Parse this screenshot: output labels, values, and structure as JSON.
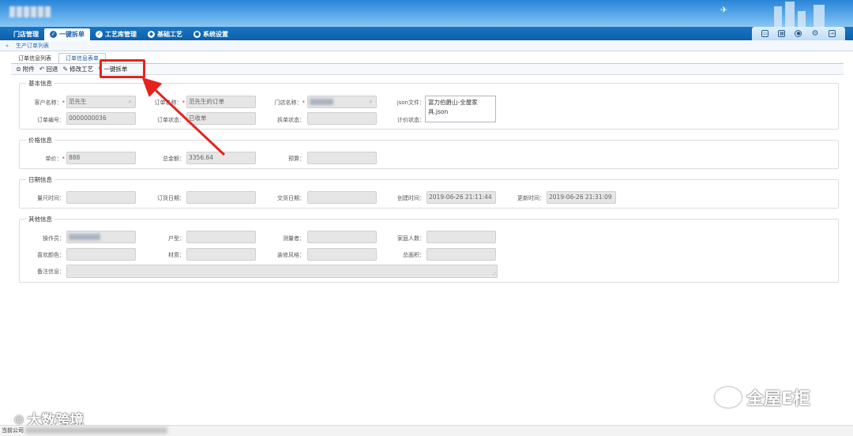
{
  "header": {
    "nav": [
      {
        "label": "门店管理",
        "icon": ""
      },
      {
        "label": "一键拆单",
        "icon": "check-circle-icon",
        "active": true
      },
      {
        "label": "工艺库管理",
        "icon": "check-circle-icon"
      },
      {
        "label": "基础工艺",
        "icon": "compass-icon"
      },
      {
        "label": "系统设置",
        "icon": "gear-circle-icon"
      }
    ],
    "tools": [
      "monitor-icon",
      "calendar-icon",
      "users-icon",
      "gear-icon",
      "exit-icon"
    ]
  },
  "breadcrumb": {
    "arrow": "»",
    "label": "生产订单列表"
  },
  "tabs": [
    {
      "label": "订单信息列表"
    },
    {
      "label": "订单信息表单",
      "active": true
    }
  ],
  "toolbar": {
    "attach_label": "附件",
    "back_label": "回退",
    "modify_label": "修改工艺",
    "split_label": "一键拆单"
  },
  "sections": {
    "basic": "基本信息",
    "price": "价格信息",
    "date": "日期信息",
    "other": "其他信息"
  },
  "basic": {
    "customer_label": "客户名称：",
    "customer_value": "范先生",
    "order_name_label": "订单名称：",
    "order_name_value": "范先生的订单",
    "store_label": "门店名称：",
    "json_label": "json文件：",
    "json_value_line1": "富力伯爵山-全屋家",
    "json_value_line2": "具.json",
    "order_no_label": "订单编号：",
    "order_no_value": "0000000036",
    "order_status_label": "订单状态：",
    "order_status_value": "已收单",
    "split_status_label": "拆单状态：",
    "price_status_label": "计价状态："
  },
  "price": {
    "unit_label": "单价：",
    "unit_value": "888",
    "total_label": "总金额：",
    "total_value": "3356.64",
    "budget_label": "预算："
  },
  "dates": {
    "measure_label": "量尺时间：",
    "order_date_label": "订货日期：",
    "delivery_label": "交货日期：",
    "created_label": "创建时间：",
    "created_value": "2019-06-26 21:11:44",
    "updated_label": "更新时间：",
    "updated_value": "2019-06-26 21:31:09"
  },
  "other": {
    "operator_label": "操作员：",
    "house_label": "户型：",
    "surveyor_label": "测量者：",
    "family_label": "家庭人数：",
    "color_label": "喜欢颜色：",
    "material_label": "材质：",
    "style_label": "装修风格：",
    "area_label": "总面积：",
    "remark_label": "备注信息："
  },
  "watermarks": {
    "right": "全屋E柜",
    "left": "大数跨境"
  },
  "footer": {
    "text": "当前公司"
  },
  "colors": {
    "accent": "#1a6bb5",
    "highlight": "#e5231c"
  }
}
